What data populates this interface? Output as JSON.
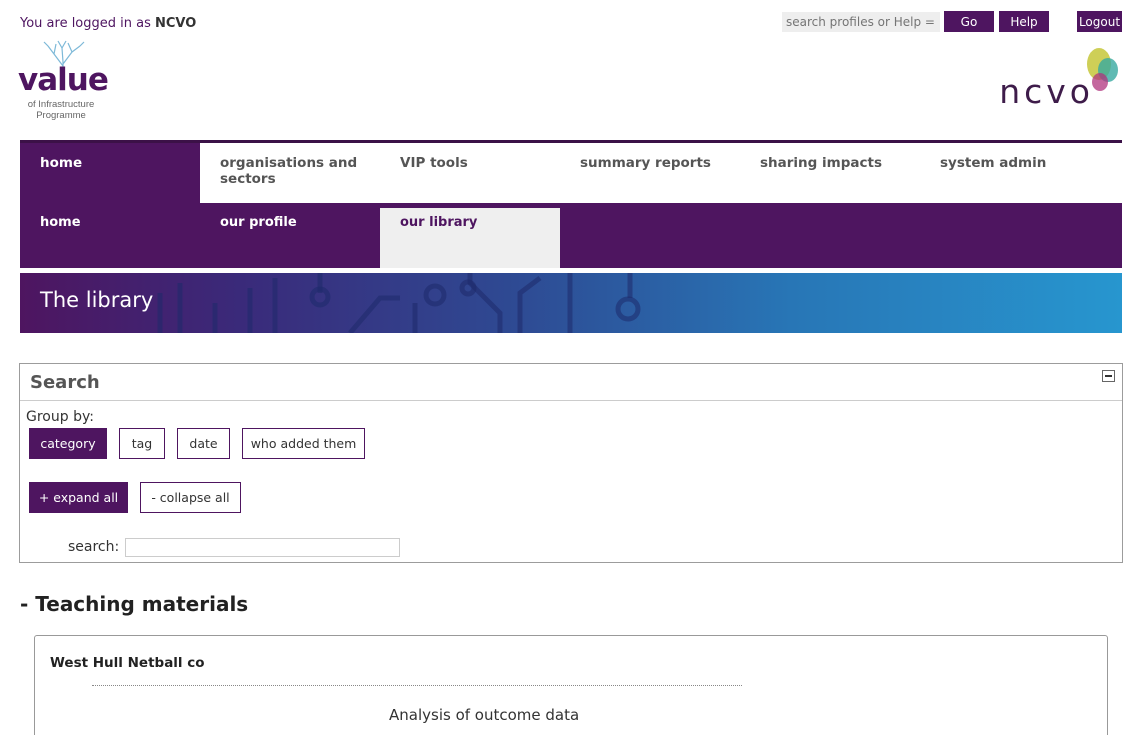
{
  "header": {
    "login_prefix": "You are logged in as ",
    "login_user": "NCVO",
    "search_placeholder": "search profiles or Help =>",
    "go_label": "Go",
    "help_label": "Help",
    "logout_label": "Logout"
  },
  "logos": {
    "value_word": "value",
    "value_sub_line1": "of Infrastructure",
    "value_sub_line2": "Programme",
    "ncvo_word": "ncvo"
  },
  "nav_main": [
    {
      "label": "home",
      "active": true
    },
    {
      "label": "organisations and sectors",
      "active": false
    },
    {
      "label": "VIP tools",
      "active": false
    },
    {
      "label": "summary reports",
      "active": false
    },
    {
      "label": "sharing impacts",
      "active": false
    },
    {
      "label": "system admin",
      "active": false
    }
  ],
  "nav_sub": [
    {
      "label": "home",
      "active": false
    },
    {
      "label": "our profile",
      "active": false
    },
    {
      "label": "our library",
      "active": true
    }
  ],
  "banner": {
    "title": "The library"
  },
  "search_panel": {
    "title": "Search",
    "group_by_label": "Group by:",
    "group_buttons": [
      "category",
      "tag",
      "date",
      "who added them"
    ],
    "expand_all": "+ expand all",
    "collapse_all": "- collapse all",
    "search_label": "search:",
    "search_value": ""
  },
  "section": {
    "title": "- Teaching materials"
  },
  "card": {
    "org": "West Hull Netball co",
    "item_title": "Analysis of outcome data"
  },
  "colors": {
    "brand": "#4e1560",
    "banner_end": "#2796cf"
  }
}
